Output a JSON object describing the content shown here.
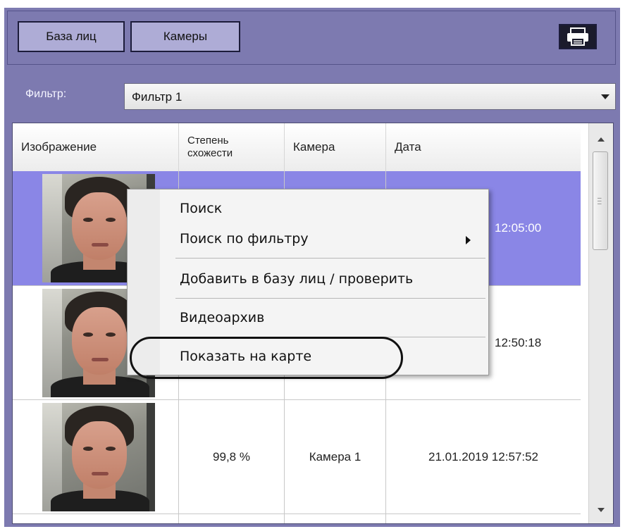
{
  "toolbar": {
    "tab_faces": "База лиц",
    "tab_cameras": "Камеры"
  },
  "filter": {
    "label": "Фильтр:",
    "value": "Фильтр 1"
  },
  "table": {
    "headers": {
      "image": "Изображение",
      "similarity_line1": "Степень",
      "similarity_line2": "схожести",
      "camera": "Камера",
      "date": "Дата"
    },
    "rows": [
      {
        "similarity": "",
        "camera": "",
        "date": "12:05:00"
      },
      {
        "similarity": "",
        "camera": "",
        "date": "12:50:18"
      },
      {
        "similarity": "99,8 %",
        "camera": "Камера 1",
        "date": "21.01.2019 12:57:52"
      }
    ]
  },
  "context_menu": {
    "items": [
      "Поиск",
      "Поиск по фильтру",
      "Добавить в базу лиц / проверить",
      "Видеоархив",
      "Показать на карте"
    ]
  }
}
